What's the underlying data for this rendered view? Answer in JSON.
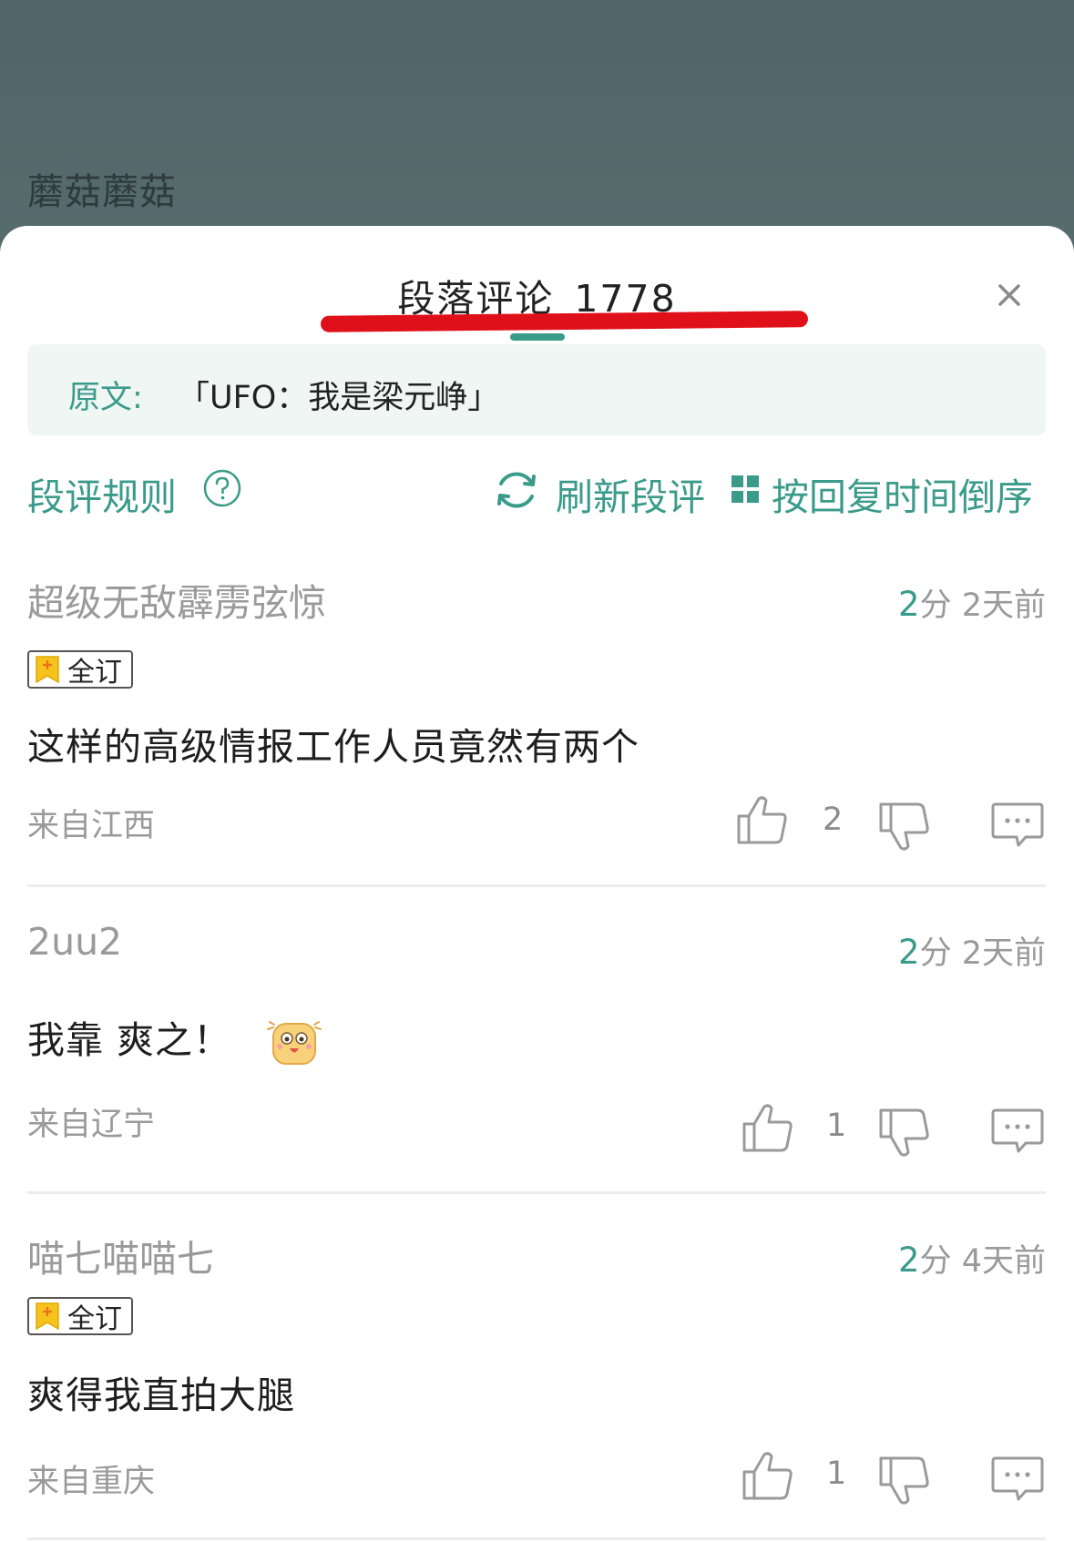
{
  "background": {
    "author": "蘑菇蘑菇"
  },
  "sheet": {
    "title": "段落评论",
    "count": "1778",
    "quote_label": "原文:",
    "quote_text": "「UFO：我是梁元峥」"
  },
  "toolbar": {
    "rules": "段评规则",
    "refresh": "刷新段评",
    "sort": "按回复时间倒序"
  },
  "colors": {
    "accent": "#3a9b8a",
    "highlight_underline": "#e0101a",
    "badge_gold": "#f5c31c"
  },
  "comments": [
    {
      "user": "超级无敌霹雳弦惊",
      "score": "2",
      "score_unit": "分",
      "time": "2天前",
      "badge": "全订",
      "text": "这样的高级情报工作人员竟然有两个",
      "location": "来自江西",
      "likes": "2"
    },
    {
      "user": "2uu2",
      "score": "2",
      "score_unit": "分",
      "time": "2天前",
      "badge": "",
      "text": "我靠 爽之！",
      "location": "来自辽宁",
      "likes": "1"
    },
    {
      "user": "喵七喵喵七",
      "score": "2",
      "score_unit": "分",
      "time": "4天前",
      "badge": "全订",
      "text": "爽得我直拍大腿",
      "location": "来自重庆",
      "likes": "1"
    }
  ]
}
